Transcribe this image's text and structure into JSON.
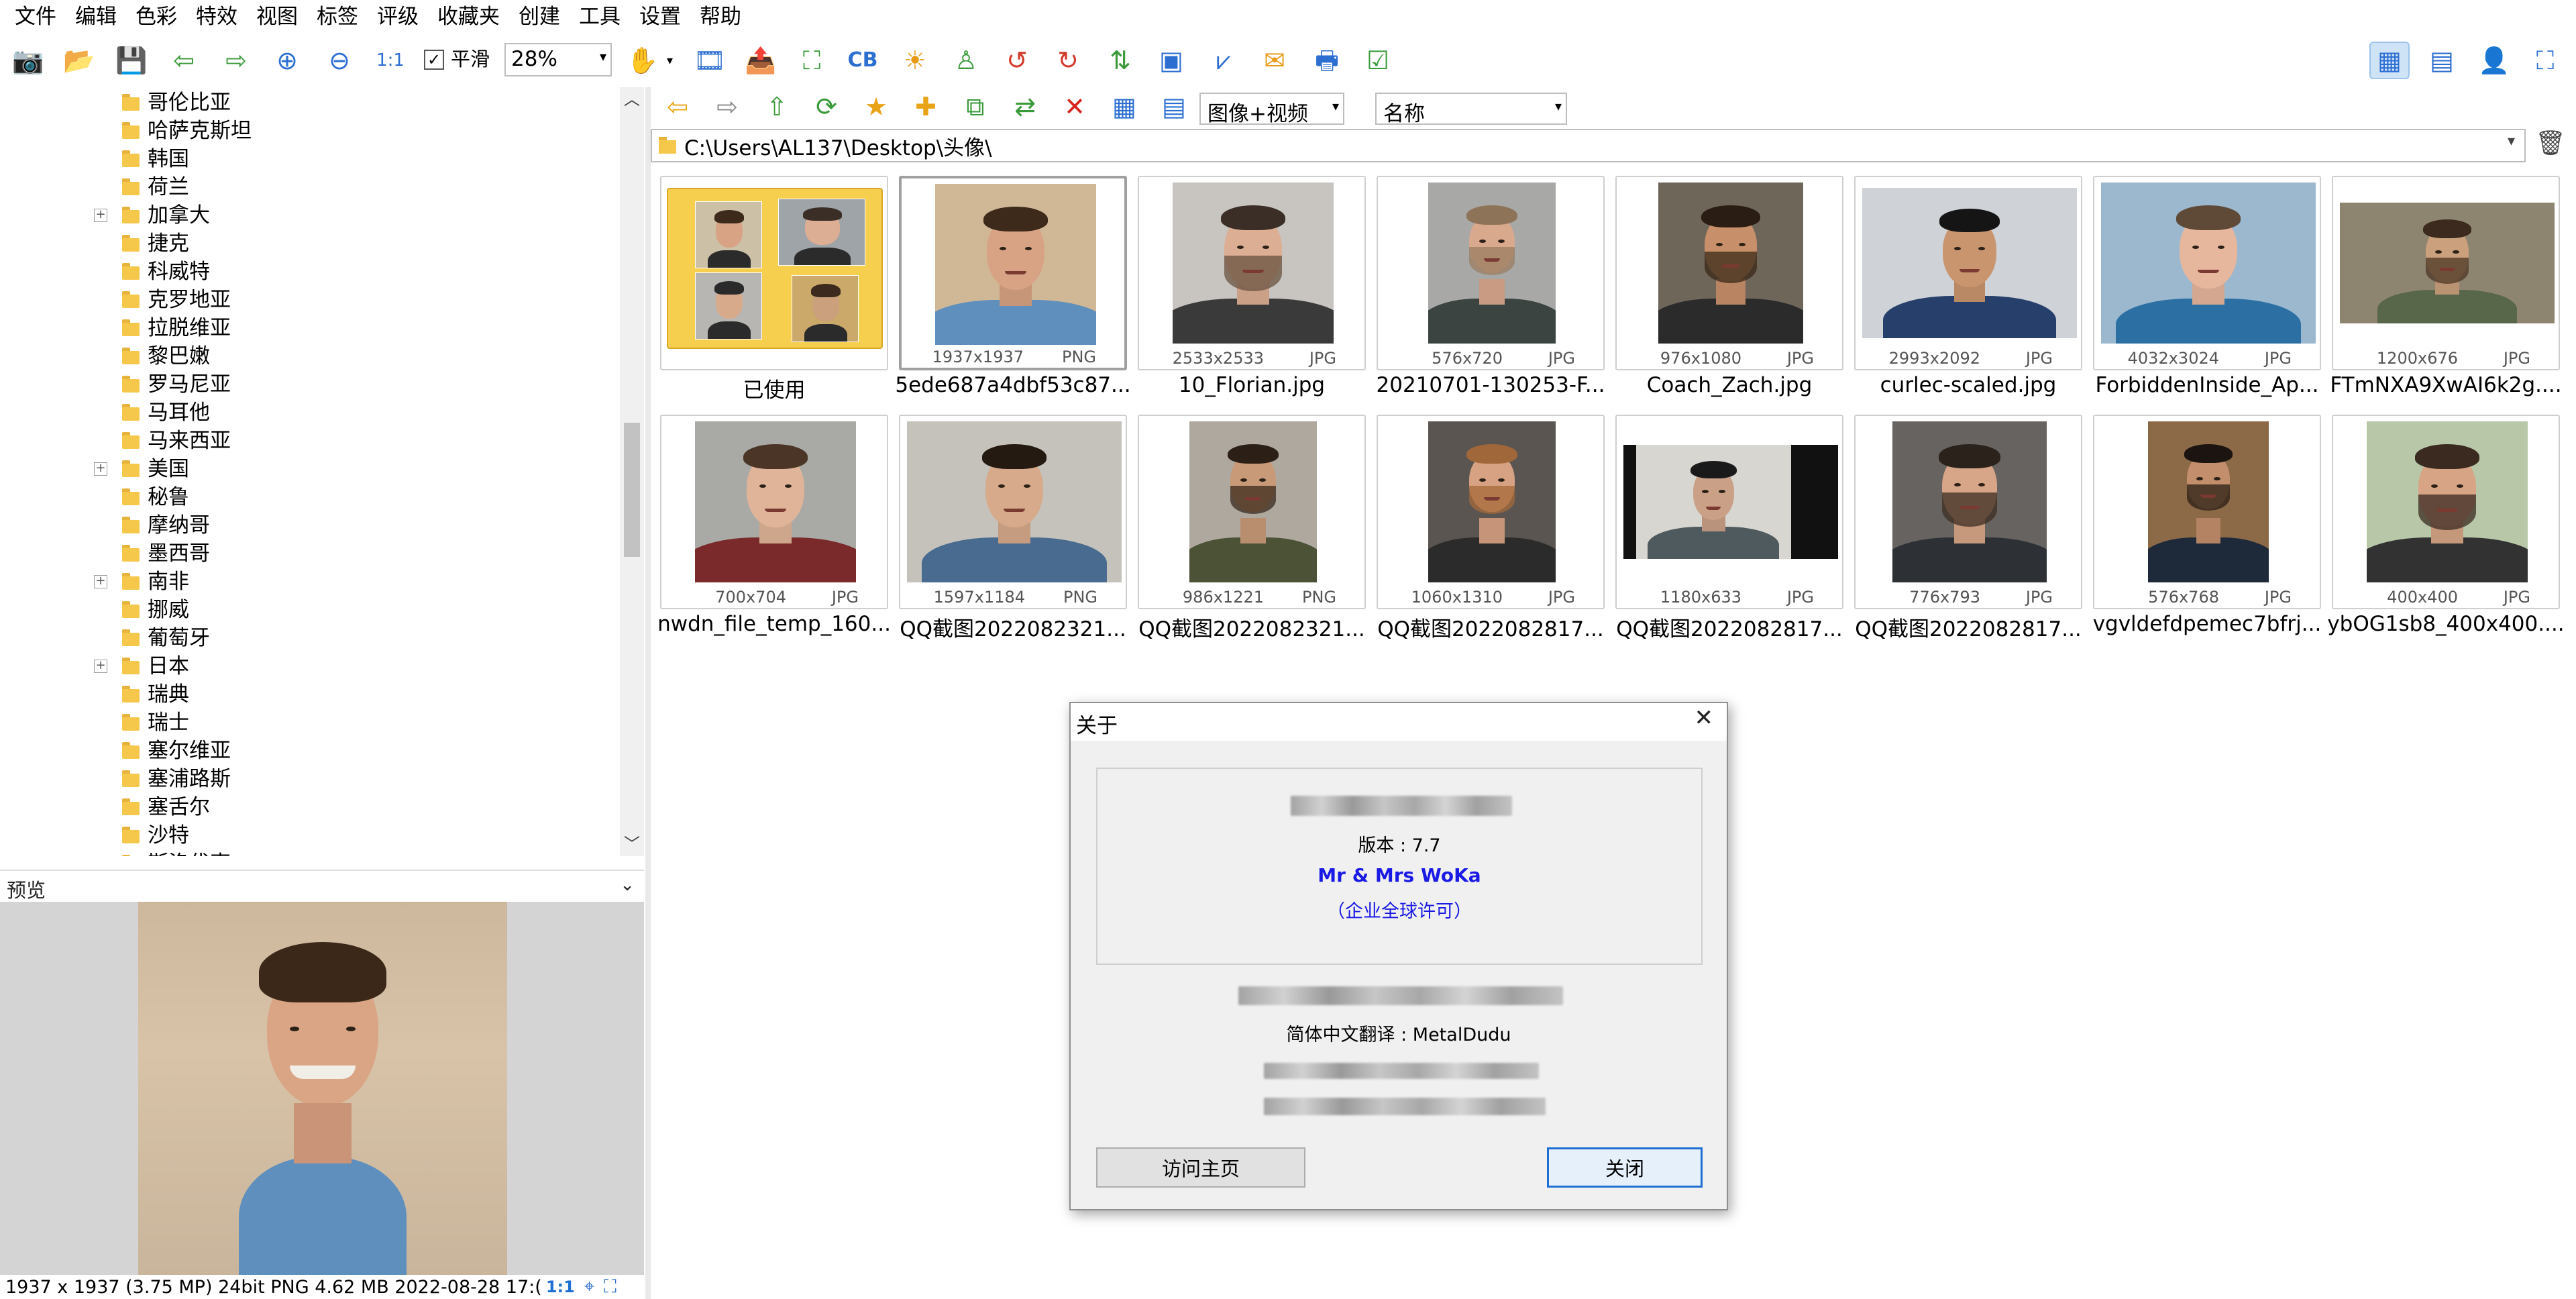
{
  "menu": [
    "文件",
    "编辑",
    "色彩",
    "特效",
    "视图",
    "标签",
    "评级",
    "收藏夹",
    "创建",
    "工具",
    "设置",
    "帮助"
  ],
  "toolbar": {
    "smooth_label": "平滑",
    "zoom_value": "28%",
    "icons": [
      "camera-icon",
      "open-folder-icon",
      "save-icon",
      "prev-icon",
      "next-icon",
      "zoom-in-icon",
      "zoom-out-icon",
      "actual-size-icon"
    ],
    "icons2": [
      "filmstrip-icon",
      "export-icon",
      "crop-icon",
      "color-balance-icon",
      "sun-icon",
      "stamp-icon",
      "rotate-left-icon",
      "rotate-right-icon",
      "resize-icon",
      "slideshow-icon",
      "adjust-icon",
      "email-icon",
      "print-icon",
      "checklist-icon"
    ],
    "view_icons": [
      "thumbnail-view-icon",
      "detail-view-icon",
      "person-view-icon",
      "fullscreen-icon"
    ]
  },
  "tree": {
    "items": [
      {
        "label": "哥伦比亚",
        "expandable": false
      },
      {
        "label": "哈萨克斯坦",
        "expandable": false
      },
      {
        "label": "韩国",
        "expandable": false
      },
      {
        "label": "荷兰",
        "expandable": false
      },
      {
        "label": "加拿大",
        "expandable": true
      },
      {
        "label": "捷克",
        "expandable": false
      },
      {
        "label": "科威特",
        "expandable": false
      },
      {
        "label": "克罗地亚",
        "expandable": false
      },
      {
        "label": "拉脱维亚",
        "expandable": false
      },
      {
        "label": "黎巴嫩",
        "expandable": false
      },
      {
        "label": "罗马尼亚",
        "expandable": false
      },
      {
        "label": "马耳他",
        "expandable": false
      },
      {
        "label": "马来西亚",
        "expandable": false
      },
      {
        "label": "美国",
        "expandable": true
      },
      {
        "label": "秘鲁",
        "expandable": false
      },
      {
        "label": "摩纳哥",
        "expandable": false
      },
      {
        "label": "墨西哥",
        "expandable": false
      },
      {
        "label": "南非",
        "expandable": true
      },
      {
        "label": "挪威",
        "expandable": false
      },
      {
        "label": "葡萄牙",
        "expandable": false
      },
      {
        "label": "日本",
        "expandable": true
      },
      {
        "label": "瑞典",
        "expandable": false
      },
      {
        "label": "瑞士",
        "expandable": false
      },
      {
        "label": "塞尔维亚",
        "expandable": false
      },
      {
        "label": "塞浦路斯",
        "expandable": false
      },
      {
        "label": "塞舌尔",
        "expandable": false
      },
      {
        "label": "沙特",
        "expandable": false
      },
      {
        "label": "斯洛伐克",
        "expandable": false
      }
    ]
  },
  "preview": {
    "title": "预览",
    "status": "1937 x 1937 (3.75 MP)   24bit   PNG    4.62 MB    2022-08-28 17:(",
    "ratio": "1:1"
  },
  "filter_select": "图像+视频",
  "sort_select": "名称",
  "path": "C:\\Users\\AL137\\Desktop\\头像\\",
  "thumbnails": [
    {
      "name": "已使用",
      "dim": "",
      "ext": "",
      "folder": true
    },
    {
      "name": "5ede687a4dbf53c87...",
      "dim": "1937x1937",
      "ext": "PNG",
      "selected": true
    },
    {
      "name": "10_Florian.jpg",
      "dim": "2533x2533",
      "ext": "JPG"
    },
    {
      "name": "20210701-130253-F...",
      "dim": "576x720",
      "ext": "JPG"
    },
    {
      "name": "Coach_Zach.jpg",
      "dim": "976x1080",
      "ext": "JPG"
    },
    {
      "name": "curlec-scaled.jpg",
      "dim": "2993x2092",
      "ext": "JPG"
    },
    {
      "name": "ForbiddenInside_Ap...",
      "dim": "4032x3024",
      "ext": "JPG"
    },
    {
      "name": "FTmNXA9XwAI6k2g....",
      "dim": "1200x676",
      "ext": "JPG"
    },
    {
      "name": "nwdn_file_temp_160...",
      "dim": "700x704",
      "ext": "JPG"
    },
    {
      "name": "QQ截图2022082321...",
      "dim": "1597x1184",
      "ext": "PNG"
    },
    {
      "name": "QQ截图2022082321...",
      "dim": "986x1221",
      "ext": "PNG"
    },
    {
      "name": "QQ截图2022082817...",
      "dim": "1060x1310",
      "ext": "JPG"
    },
    {
      "name": "QQ截图2022082817...",
      "dim": "1180x633",
      "ext": "JPG"
    },
    {
      "name": "QQ截图2022082817...",
      "dim": "776x793",
      "ext": "JPG"
    },
    {
      "name": "vgvldefdpemec7bfrj...",
      "dim": "576x768",
      "ext": "JPG"
    },
    {
      "name": "ybOG1sb8_400x400....",
      "dim": "400x400",
      "ext": "JPG"
    }
  ],
  "dialog": {
    "title": "关于",
    "version": "版本 : 7.7",
    "licensee": "Mr & Mrs WoKa",
    "license": "（企业全球许可）",
    "translator": "简体中文翻译 : MetalDudu",
    "homepage_button": "访问主页",
    "close_button": "关闭",
    "accent_color": "#1a1ae6"
  }
}
